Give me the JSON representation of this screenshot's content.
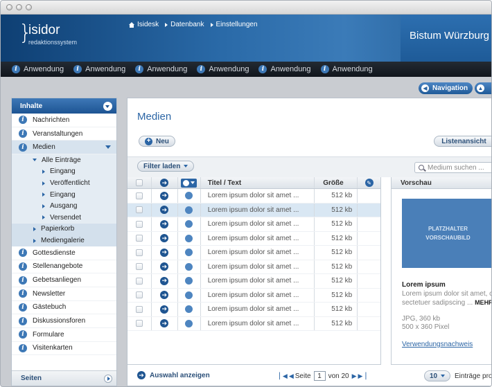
{
  "header": {
    "logo_name": "isidor",
    "logo_sub": "redaktionssystem",
    "breadcrumb": [
      "Isidesk",
      "Datenbank",
      "Einstellungen"
    ],
    "site_title": "Bistum Würzburg"
  },
  "appbar": {
    "items": [
      "Anwendung",
      "Anwendung",
      "Anwendung",
      "Anwendung",
      "Anwendung",
      "Anwendung"
    ]
  },
  "navigation": {
    "label": "Navigation"
  },
  "sidebar": {
    "title": "Inhalte",
    "items_top": [
      "Nachrichten",
      "Veranstaltungen"
    ],
    "active_item": "Medien",
    "tree_root": "Alle Einträge",
    "tree_children": [
      "Eingang",
      "Veröffentlicht",
      "Eingang",
      "Ausgang",
      "Versendet"
    ],
    "tree_siblings": [
      "Papierkorb",
      "Mediengalerie"
    ],
    "items_bottom": [
      "Gottesdienste",
      "Stellenangebote",
      "Gebetsanliegen",
      "Newsletter",
      "Gästebuch",
      "Diskussionsforen",
      "Formulare",
      "Visitenkarten"
    ],
    "footer": "Seiten"
  },
  "main": {
    "title": "Medien",
    "new_button": "Neu",
    "list_view_button": "Listenansicht",
    "filter_button": "Filter laden",
    "search_placeholder": "Medium suchen ..."
  },
  "table": {
    "headers": {
      "title": "Titel / Text",
      "size": "Größe"
    },
    "rows": [
      {
        "title": "Lorem ipsum dolor sit amet ...",
        "size": "512 kb"
      },
      {
        "title": "Lorem ipsum dolor sit amet ...",
        "size": "512 kb"
      },
      {
        "title": "Lorem ipsum dolor sit amet ...",
        "size": "512 kb"
      },
      {
        "title": "Lorem ipsum dolor sit amet ...",
        "size": "512 kb"
      },
      {
        "title": "Lorem ipsum dolor sit amet ...",
        "size": "512 kb"
      },
      {
        "title": "Lorem ipsum dolor sit amet ...",
        "size": "512 kb"
      },
      {
        "title": "Lorem ipsum dolor sit amet ...",
        "size": "512 kb"
      },
      {
        "title": "Lorem ipsum dolor sit amet ...",
        "size": "512 kb"
      },
      {
        "title": "Lorem ipsum dolor sit amet ...",
        "size": "512 kb"
      },
      {
        "title": "Lorem ipsum dolor sit amet ...",
        "size": "512 kb"
      }
    ],
    "selected_row": 1
  },
  "preview": {
    "title": "Vorschau",
    "placeholder_line1": "PLATZHALTER",
    "placeholder_line2": "VORSCHAUBILD",
    "item_title": "Lorem ipsum",
    "text_line1": "Lorem ipsum dolor sit amet, co",
    "text_line2": "sectetuer sadipscing  ...",
    "more": "MEHR",
    "meta_line1": "JPG, 360 kb",
    "meta_line2": "500 x 360 Pixel",
    "link": "Verwendungsnachweis"
  },
  "footer": {
    "show_selection": "Auswahl anzeigen",
    "page_label": "Seite",
    "page_current": "1",
    "page_of": "von 20",
    "per_page_value": "10",
    "per_page_label": "Einträge pro"
  },
  "colors": {
    "accent": "#2b65a5",
    "header_dark": "#0e3f73",
    "appbar": "#1a2028"
  }
}
